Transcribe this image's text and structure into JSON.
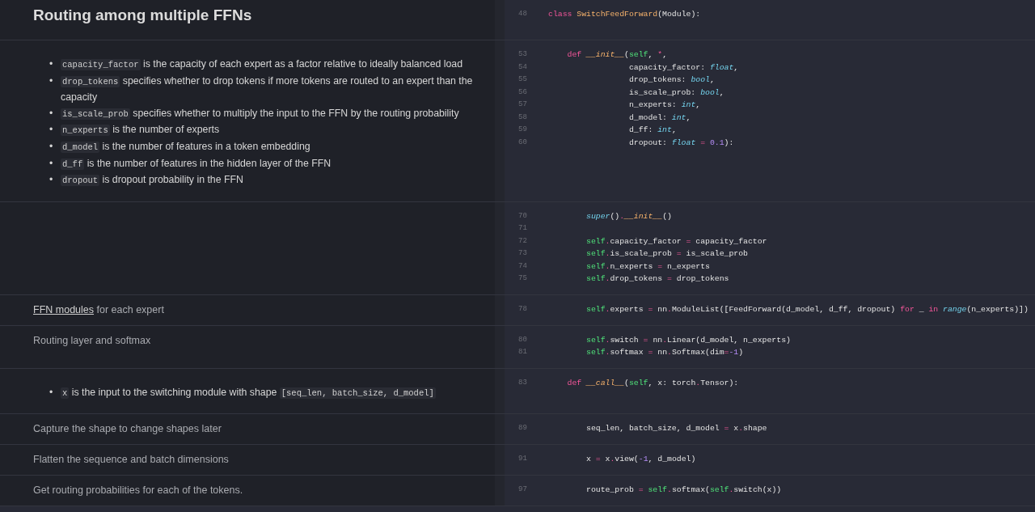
{
  "sections": [
    {
      "doc": {
        "kind": "heading",
        "text": "Routing among multiple FFNs"
      },
      "code": [
        {
          "n": "48",
          "tokens": [
            {
              "text": "class ",
              "kind": "keyword"
            },
            {
              "text": "SwitchFeedForward",
              "kind": "class"
            },
            {
              "text": "(Module):",
              "kind": "plain"
            }
          ]
        }
      ]
    },
    {
      "doc": {
        "kind": "bullets",
        "marker": "•",
        "items": [
          [
            {
              "code": "capacity_factor"
            },
            {
              "text": "is the capacity of each expert as a factor relative to ideally balanced load"
            }
          ],
          [
            {
              "code": "drop_tokens"
            },
            {
              "text": "specifies whether to drop tokens if more tokens are routed to an expert than the capacity"
            }
          ],
          [
            {
              "code": "is_scale_prob"
            },
            {
              "text": "specifies whether to multiply the input to the FFN by the routing probability"
            }
          ],
          [
            {
              "code": "n_experts"
            },
            {
              "text": "is the number of experts"
            }
          ],
          [
            {
              "code": "d_model"
            },
            {
              "text": "is the number of features in a token embedding"
            }
          ],
          [
            {
              "code": "d_ff"
            },
            {
              "text": "is the number of features in the hidden layer of the FFN"
            }
          ],
          [
            {
              "code": "dropout"
            },
            {
              "text": "is dropout probability in the FFN"
            }
          ]
        ]
      },
      "code": [
        {
          "n": "53",
          "tokens": [
            {
              "text": "    def ",
              "kind": "keyword"
            },
            {
              "text": "__init__",
              "kind": "function"
            },
            {
              "text": "(",
              "kind": "plain"
            },
            {
              "text": "self",
              "kind": "self"
            },
            {
              "text": ", ",
              "kind": "plain"
            },
            {
              "text": "*",
              "kind": "operator"
            },
            {
              "text": ",",
              "kind": "plain"
            }
          ]
        },
        {
          "n": "54",
          "tokens": [
            {
              "text": "                 capacity_factor: ",
              "kind": "plain"
            },
            {
              "text": "float",
              "kind": "builtin"
            },
            {
              "text": ",",
              "kind": "plain"
            }
          ]
        },
        {
          "n": "55",
          "tokens": [
            {
              "text": "                 drop_tokens: ",
              "kind": "plain"
            },
            {
              "text": "bool",
              "kind": "builtin"
            },
            {
              "text": ",",
              "kind": "plain"
            }
          ]
        },
        {
          "n": "56",
          "tokens": [
            {
              "text": "                 is_scale_prob: ",
              "kind": "plain"
            },
            {
              "text": "bool",
              "kind": "builtin"
            },
            {
              "text": ",",
              "kind": "plain"
            }
          ]
        },
        {
          "n": "57",
          "tokens": [
            {
              "text": "                 n_experts: ",
              "kind": "plain"
            },
            {
              "text": "int",
              "kind": "builtin"
            },
            {
              "text": ",",
              "kind": "plain"
            }
          ]
        },
        {
          "n": "58",
          "tokens": [
            {
              "text": "                 d_model: ",
              "kind": "plain"
            },
            {
              "text": "int",
              "kind": "builtin"
            },
            {
              "text": ",",
              "kind": "plain"
            }
          ]
        },
        {
          "n": "59",
          "tokens": [
            {
              "text": "                 d_ff: ",
              "kind": "plain"
            },
            {
              "text": "int",
              "kind": "builtin"
            },
            {
              "text": ",",
              "kind": "plain"
            }
          ]
        },
        {
          "n": "60",
          "tokens": [
            {
              "text": "                 dropout: ",
              "kind": "plain"
            },
            {
              "text": "float ",
              "kind": "builtin"
            },
            {
              "text": "= ",
              "kind": "operator"
            },
            {
              "text": "0.1",
              "kind": "number"
            },
            {
              "text": "):",
              "kind": "plain"
            }
          ]
        }
      ]
    },
    {
      "doc": {
        "kind": "empty"
      },
      "code": [
        {
          "n": "70",
          "tokens": [
            {
              "text": "        super",
              "kind": "builtin"
            },
            {
              "text": "()",
              "kind": "plain"
            },
            {
              "text": ".",
              "kind": "operator"
            },
            {
              "text": "__init__",
              "kind": "function"
            },
            {
              "text": "()",
              "kind": "plain"
            }
          ]
        },
        {
          "n": "71"
        },
        {
          "n": "72",
          "tokens": [
            {
              "text": "        self",
              "kind": "self"
            },
            {
              "text": ".",
              "kind": "operator"
            },
            {
              "text": "capacity_factor ",
              "kind": "plain"
            },
            {
              "text": "=",
              "kind": "operator"
            },
            {
              "text": " capacity_factor",
              "kind": "plain"
            }
          ]
        },
        {
          "n": "73",
          "tokens": [
            {
              "text": "        self",
              "kind": "self"
            },
            {
              "text": ".",
              "kind": "operator"
            },
            {
              "text": "is_scale_prob ",
              "kind": "plain"
            },
            {
              "text": "=",
              "kind": "operator"
            },
            {
              "text": " is_scale_prob",
              "kind": "plain"
            }
          ]
        },
        {
          "n": "74",
          "tokens": [
            {
              "text": "        self",
              "kind": "self"
            },
            {
              "text": ".",
              "kind": "operator"
            },
            {
              "text": "n_experts ",
              "kind": "plain"
            },
            {
              "text": "=",
              "kind": "operator"
            },
            {
              "text": " n_experts",
              "kind": "plain"
            }
          ]
        },
        {
          "n": "75",
          "tokens": [
            {
              "text": "        self",
              "kind": "self"
            },
            {
              "text": ".",
              "kind": "operator"
            },
            {
              "text": "drop_tokens ",
              "kind": "plain"
            },
            {
              "text": "=",
              "kind": "operator"
            },
            {
              "text": " drop_tokens",
              "kind": "plain"
            }
          ]
        }
      ]
    },
    {
      "doc": {
        "kind": "paragraph",
        "parts": [
          {
            "link": "FFN modules"
          },
          {
            "text": " for each expert"
          }
        ]
      },
      "code": [
        {
          "n": "78",
          "tokens": [
            {
              "text": "        self",
              "kind": "self"
            },
            {
              "text": ".",
              "kind": "operator"
            },
            {
              "text": "experts ",
              "kind": "plain"
            },
            {
              "text": "=",
              "kind": "operator"
            },
            {
              "text": " nn",
              "kind": "plain"
            },
            {
              "text": ".",
              "kind": "operator"
            },
            {
              "text": "ModuleList([FeedForward(d_model, d_ff, dropout) ",
              "kind": "plain"
            },
            {
              "text": "for",
              "kind": "keyword"
            },
            {
              "text": " _ ",
              "kind": "plain"
            },
            {
              "text": "in ",
              "kind": "keyword"
            },
            {
              "text": "range",
              "kind": "builtin"
            },
            {
              "text": "(n_experts)])",
              "kind": "plain"
            }
          ]
        }
      ]
    },
    {
      "doc": {
        "kind": "paragraph",
        "parts": [
          {
            "text": "Routing layer and softmax"
          }
        ]
      },
      "code": [
        {
          "n": "80",
          "tokens": [
            {
              "text": "        self",
              "kind": "self"
            },
            {
              "text": ".",
              "kind": "operator"
            },
            {
              "text": "switch ",
              "kind": "plain"
            },
            {
              "text": "=",
              "kind": "operator"
            },
            {
              "text": " nn",
              "kind": "plain"
            },
            {
              "text": ".",
              "kind": "operator"
            },
            {
              "text": "Linear(d_model, n_experts)",
              "kind": "plain"
            }
          ]
        },
        {
          "n": "81",
          "tokens": [
            {
              "text": "        self",
              "kind": "self"
            },
            {
              "text": ".",
              "kind": "operator"
            },
            {
              "text": "softmax ",
              "kind": "plain"
            },
            {
              "text": "=",
              "kind": "operator"
            },
            {
              "text": " nn",
              "kind": "plain"
            },
            {
              "text": ".",
              "kind": "operator"
            },
            {
              "text": "Softmax(dim",
              "kind": "plain"
            },
            {
              "text": "=",
              "kind": "operator"
            },
            {
              "text": "-1",
              "kind": "number"
            },
            {
              "text": ")",
              "kind": "plain"
            }
          ]
        }
      ]
    },
    {
      "doc": {
        "kind": "bullets",
        "marker": "•",
        "items": [
          [
            {
              "code": "x"
            },
            {
              "text": "is the input to the switching module with shape"
            },
            {
              "code": "[seq_len, batch_size, d_model]"
            }
          ]
        ]
      },
      "code": [
        {
          "n": "83",
          "tokens": [
            {
              "text": "    def ",
              "kind": "keyword"
            },
            {
              "text": "__call__",
              "kind": "function"
            },
            {
              "text": "(",
              "kind": "plain"
            },
            {
              "text": "self",
              "kind": "self"
            },
            {
              "text": ", x: torch",
              "kind": "plain"
            },
            {
              "text": ".",
              "kind": "operator"
            },
            {
              "text": "Tensor):",
              "kind": "plain"
            }
          ]
        }
      ]
    },
    {
      "doc": {
        "kind": "paragraph",
        "parts": [
          {
            "text": "Capture the shape to change shapes later"
          }
        ]
      },
      "code": [
        {
          "n": "89",
          "tokens": [
            {
              "text": "        seq_len, batch_size, d_model ",
              "kind": "plain"
            },
            {
              "text": "=",
              "kind": "operator"
            },
            {
              "text": " x",
              "kind": "plain"
            },
            {
              "text": ".",
              "kind": "operator"
            },
            {
              "text": "shape",
              "kind": "plain"
            }
          ]
        }
      ]
    },
    {
      "doc": {
        "kind": "paragraph",
        "parts": [
          {
            "text": "Flatten the sequence and batch dimensions"
          }
        ]
      },
      "code": [
        {
          "n": "91",
          "tokens": [
            {
              "text": "        x ",
              "kind": "plain"
            },
            {
              "text": "=",
              "kind": "operator"
            },
            {
              "text": " x",
              "kind": "plain"
            },
            {
              "text": ".",
              "kind": "operator"
            },
            {
              "text": "view(",
              "kind": "plain"
            },
            {
              "text": "-1",
              "kind": "number"
            },
            {
              "text": ", d_model)",
              "kind": "plain"
            }
          ]
        }
      ]
    },
    {
      "doc": {
        "kind": "paragraph",
        "parts": [
          {
            "text": "Get routing probabilities for each of the tokens."
          }
        ]
      },
      "code": [
        {
          "n": "97",
          "tokens": [
            {
              "text": "        route_prob ",
              "kind": "plain"
            },
            {
              "text": "=",
              "kind": "operator"
            },
            {
              "text": " self",
              "kind": "self"
            },
            {
              "text": ".",
              "kind": "operator"
            },
            {
              "text": "softmax(",
              "kind": "plain"
            },
            {
              "text": "self",
              "kind": "self"
            },
            {
              "text": ".",
              "kind": "operator"
            },
            {
              "text": "switch(x))",
              "kind": "plain"
            }
          ]
        }
      ]
    }
  ]
}
